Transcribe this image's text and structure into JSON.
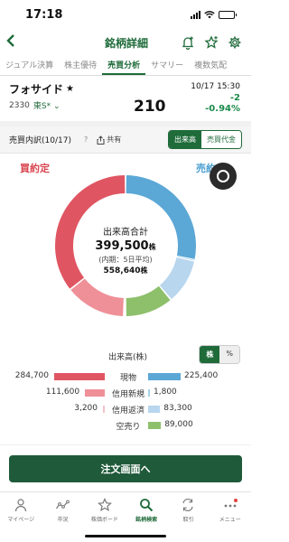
{
  "status": {
    "time": "17:18"
  },
  "nav": {
    "title": "銘柄詳細",
    "back_icon": "chevron-left-icon"
  },
  "tabs": [
    "ジュアル決算",
    "株主優待",
    "売買分析",
    "サマリー",
    "複数気配"
  ],
  "active_tab": "売買分析",
  "stock": {
    "name": "フォサイド",
    "code": "2330",
    "market": "東S*",
    "datetime": "10/17 15:30",
    "price": "210",
    "change": "-2",
    "change_pct": "-0.94%"
  },
  "section": {
    "title": "売買内訳(10/17)",
    "help": "?",
    "share_label": "共有",
    "toggle_volume": "出来高",
    "toggle_value": "売買代金"
  },
  "chart_labels": {
    "buy": "買約定",
    "sell": "売約定"
  },
  "summary": {
    "title": "出来高合計",
    "total": "399,500",
    "total_unit": "株",
    "sub_label": "(内期：5日平均)",
    "avg": "558,640",
    "avg_unit": "株"
  },
  "unit_row": {
    "label": "出来高(株)",
    "unit_shares": "株",
    "unit_pct": "%"
  },
  "chart_data": {
    "type": "pie",
    "title": "出来高合計",
    "categories": [
      "現物",
      "信用新規",
      "信用返済",
      "空売り"
    ],
    "series": [
      {
        "name": "買約定",
        "values": [
          284700,
          111600,
          3200,
          0
        ]
      },
      {
        "name": "売約定",
        "values": [
          225400,
          1800,
          83300,
          89000
        ]
      }
    ],
    "buy_colors": [
      "#e05562",
      "#ef8f98",
      "#f5c2c7"
    ],
    "sell_colors": [
      "#5ba7d6",
      "#a8d3ea",
      "#b8d6ee",
      "#8ec06c"
    ],
    "rows": [
      {
        "category": "現物",
        "buy": "284,700",
        "sell": "225,400"
      },
      {
        "category": "信用新規",
        "buy": "111,600",
        "sell": "1,800"
      },
      {
        "category": "信用返済",
        "buy": "3,200",
        "sell": "83,300"
      },
      {
        "category": "空売り",
        "buy": "",
        "sell": "89,000"
      }
    ]
  },
  "order_button": "注文画面へ",
  "bottom_nav": [
    {
      "label": "マイページ",
      "icon": "person-icon"
    },
    {
      "label": "市況",
      "icon": "market-icon"
    },
    {
      "label": "株価ボード",
      "icon": "star-icon"
    },
    {
      "label": "銘柄検索",
      "icon": "search-icon"
    },
    {
      "label": "取引",
      "icon": "trade-icon"
    },
    {
      "label": "メニュー",
      "icon": "menu-icon"
    }
  ],
  "active_nav": "銘柄検索"
}
